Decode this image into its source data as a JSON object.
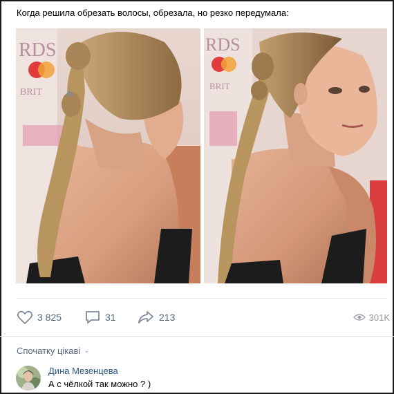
{
  "post": {
    "text": "Когда решила обрезать волосы, обрезала, но резко передумала:"
  },
  "actions": {
    "likes": "3 825",
    "comments": "31",
    "shares": "213",
    "views": "301K"
  },
  "comments_section": {
    "sort_label": "Спочатку цікаві",
    "comment": {
      "author": "Дина Мезенцева",
      "text": "А с чёлкой так можно ? )"
    }
  },
  "colors": {
    "link": "#2a5885",
    "action": "#55677d",
    "muted": "#939699",
    "divider": "#e7e8ec"
  }
}
